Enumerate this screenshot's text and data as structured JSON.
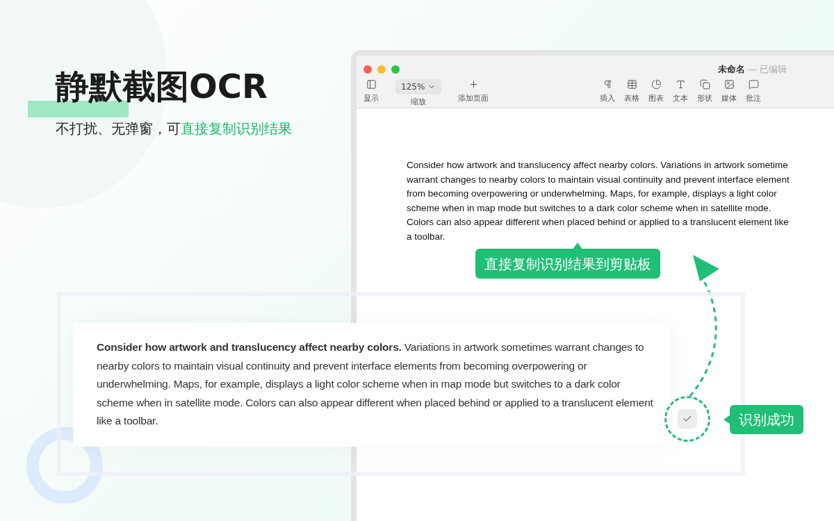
{
  "headline": {
    "title": "静默截图OCR",
    "subtitle": "不打扰、无弹窗，可",
    "subtitle_highlight": "直接复制识别结果"
  },
  "window": {
    "title": "未命名",
    "separator": "—",
    "status": "已编辑",
    "toolbar_left": [
      {
        "kind": "button",
        "label": "显示"
      },
      {
        "kind": "dropdown",
        "value": "125%",
        "label": "缩放"
      },
      {
        "kind": "button",
        "label": "添加页面"
      }
    ],
    "toolbar_right": [
      {
        "kind": "button",
        "label": "插入"
      },
      {
        "kind": "button",
        "label": "表格"
      },
      {
        "kind": "button",
        "label": "图表"
      },
      {
        "kind": "button",
        "label": "文本"
      },
      {
        "kind": "button",
        "label": "形状"
      },
      {
        "kind": "button",
        "label": "媒体"
      },
      {
        "kind": "button",
        "label": "批注"
      }
    ],
    "document_lines": [
      "Consider how artwork and translucency affect nearby colors. Variations in artwork sometime",
      "warrant changes to nearby colors to maintain visual continuity and prevent interface element",
      "from becoming overpowering or underwhelming. Maps, for example, displays a light color",
      "scheme when in map mode but switches to a dark color scheme when in satellite mode.",
      "Colors can also appear different when placed behind or applied to a translucent element like",
      "a toolbar."
    ]
  },
  "copy_callout": "直接复制识别结果到剪贴板",
  "ocr_result": {
    "text": "**Consider how artwork and translucency affect nearby colors.** Variations in artwork sometimes warrant changes to nearby colors to maintain visual continuity and prevent interface elements from becoming overpowering or underwhelming. Maps, for example, displays a light color scheme when in map mode but switches to a dark color scheme when in satellite mode. Colors can also appear different when placed behind or applied to a translucent element like a toolbar.",
    "checked": true
  },
  "success_badge": "识别成功"
}
